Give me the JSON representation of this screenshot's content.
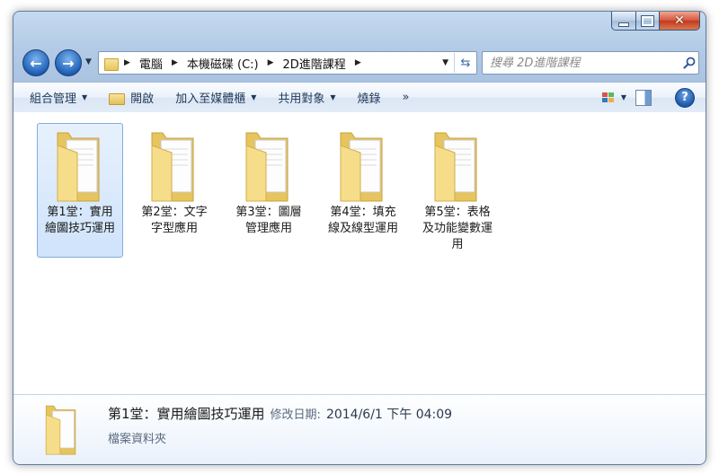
{
  "window": {
    "close_glyph": "✕"
  },
  "nav": {
    "back_glyph": "←",
    "forward_glyph": "→",
    "breadcrumb": [
      "電腦",
      "本機磁碟 (C:)",
      "2D進階課程"
    ],
    "search_placeholder": "搜尋 2D進階課程"
  },
  "toolbar": {
    "organize": "組合管理",
    "open": "開啟",
    "add_to_library": "加入至媒體櫃",
    "share_with": "共用對象",
    "burn": "燒錄",
    "more": "»"
  },
  "folders": [
    {
      "label": "第1堂：實用繪圖技巧運用",
      "selected": true
    },
    {
      "label": "第2堂：文字字型應用",
      "selected": false
    },
    {
      "label": "第3堂：圖層管理應用",
      "selected": false
    },
    {
      "label": "第4堂：填充線及線型運用",
      "selected": false
    },
    {
      "label": "第5堂：表格及功能變數運用",
      "selected": false
    }
  ],
  "details": {
    "name": "第1堂：實用繪圖技巧運用",
    "modified_label": "修改日期:",
    "modified_value": "2014/6/1 下午 04:09",
    "type": "檔案資料夾"
  },
  "colors": {
    "accent": "#1f5fb6",
    "folder": "#f3d77c",
    "selection": "#cfe3fb"
  }
}
